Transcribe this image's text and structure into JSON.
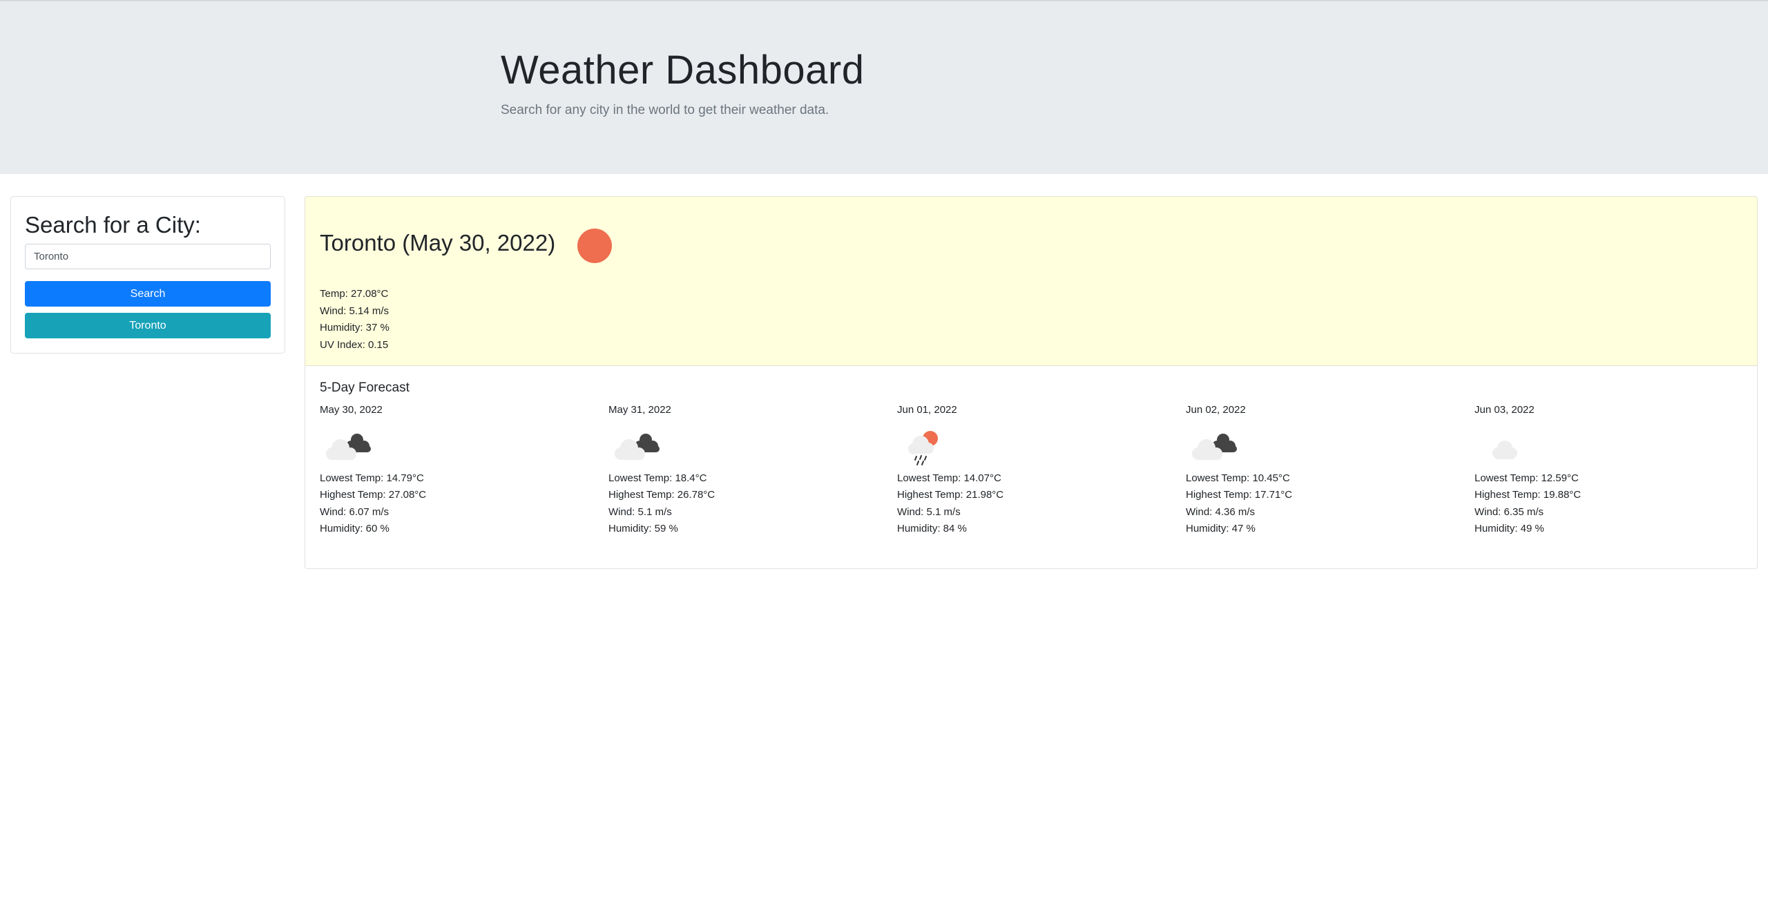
{
  "header": {
    "title": "Weather Dashboard",
    "lead": "Search for any city in the world to get their weather data."
  },
  "search": {
    "title": "Search for a City:",
    "input_value": "Toronto",
    "button_label": "Search",
    "history": [
      "Toronto"
    ]
  },
  "current": {
    "title": "Toronto (May 30, 2022)",
    "icon": "clear-day-sun-icon",
    "temp": "Temp: 27.08°C",
    "wind": "Wind: 5.14 m/s",
    "humidity": "Humidity: 37 %",
    "uv": "UV Index: 0.15"
  },
  "forecast": {
    "title": "5-Day Forecast",
    "days": [
      {
        "date": "May 30, 2022",
        "icon": "broken-clouds-icon",
        "low": "Lowest Temp: 14.79°C",
        "high": "Highest Temp: 27.08°C",
        "wind": "Wind: 6.07 m/s",
        "humidity": "Humidity: 60 %"
      },
      {
        "date": "May 31, 2022",
        "icon": "broken-clouds-icon",
        "low": "Lowest Temp: 18.4°C",
        "high": "Highest Temp: 26.78°C",
        "wind": "Wind: 5.1 m/s",
        "humidity": "Humidity: 59 %"
      },
      {
        "date": "Jun 01, 2022",
        "icon": "rain-sun-icon",
        "low": "Lowest Temp: 14.07°C",
        "high": "Highest Temp: 21.98°C",
        "wind": "Wind: 5.1 m/s",
        "humidity": "Humidity: 84 %"
      },
      {
        "date": "Jun 02, 2022",
        "icon": "broken-clouds-icon",
        "low": "Lowest Temp: 10.45°C",
        "high": "Highest Temp: 17.71°C",
        "wind": "Wind: 4.36 m/s",
        "humidity": "Humidity: 47 %"
      },
      {
        "date": "Jun 03, 2022",
        "icon": "overcast-cloud-icon",
        "low": "Lowest Temp: 12.59°C",
        "high": "Highest Temp: 19.88°C",
        "wind": "Wind: 6.35 m/s",
        "humidity": "Humidity: 49 %"
      }
    ]
  },
  "colors": {
    "jumbotron_bg": "#e9ecef",
    "search_button": "#0d7bfd",
    "history_button": "#17a2b8",
    "current_bg": "#fffedd",
    "sun": "#ee6e4f",
    "cloud_light": "#eeeeee",
    "cloud_dark": "#444444"
  }
}
